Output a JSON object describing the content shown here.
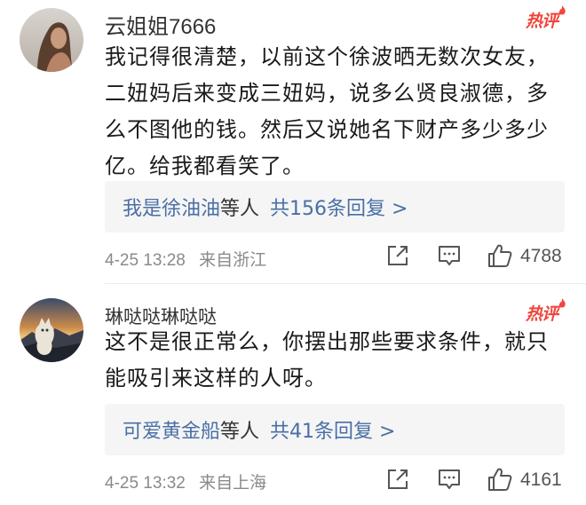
{
  "hot_label": "热评",
  "comments": [
    {
      "username": "云姐姐7666",
      "text": "我记得很清楚，以前这个徐波晒无数次女友，二妞妈后来变成三妞妈，说多么贤良淑德，多么不图他的钱。然后又说她名下财产多少多少亿。给我都看笑了。",
      "reply_names": "我是徐油油",
      "reply_suffix": "等人",
      "reply_count": "共156条回复 >",
      "date": "4-25 13:28",
      "location": "来自浙江",
      "likes": "4788"
    },
    {
      "username": "琳哒哒琳哒哒",
      "text": "这不是很正常么，你摆出那些要求条件，就只能吸引来这样的人呀。",
      "reply_names": "可爱黄金船",
      "reply_suffix": "等人",
      "reply_count": "共41条回复 >",
      "date": "4-25 13:32",
      "location": "来自上海",
      "likes": "4161"
    }
  ],
  "icons": {
    "share": "share-icon",
    "comment": "comment-icon",
    "like": "like-icon",
    "hot": "flame-icon"
  },
  "colors": {
    "link": "#4a6fa5",
    "hot": "#f0463c",
    "meta": "#8a8a8a",
    "reply_bg": "#f5f5f5"
  }
}
